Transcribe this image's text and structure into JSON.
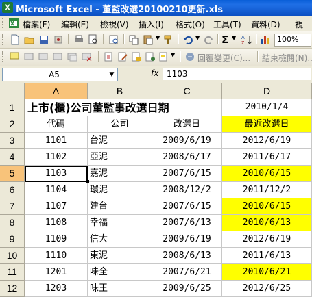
{
  "window": {
    "title": "Microsoft Excel - 董監改選20100210更新.xls",
    "app_icon_letter": "X"
  },
  "menu": [
    "檔案(F)",
    "編輯(E)",
    "檢視(V)",
    "插入(I)",
    "格式(O)",
    "工具(T)",
    "資料(D)",
    "視"
  ],
  "toolbar": {
    "zoom": "100%",
    "sigma": "Σ",
    "reply_changes": "回覆變更(C)...",
    "end_review": "結束檢閱(N)..."
  },
  "formula_bar": {
    "name_box": "A5",
    "fx_label": "fx",
    "content": "1103"
  },
  "columns": [
    "A",
    "B",
    "C",
    "D"
  ],
  "rows": [
    "1",
    "2",
    "3",
    "4",
    "5",
    "6",
    "7",
    "8",
    "9",
    "10",
    "11",
    "12"
  ],
  "sheet": {
    "title": "上市(櫃)公司董監事改選日期",
    "title_date": "2010/1/4",
    "headers": [
      "代碼",
      "公司",
      "改選日",
      "最近改選日"
    ],
    "records": [
      [
        "1101",
        "台泥",
        "2009/6/19",
        "2012/6/19"
      ],
      [
        "1102",
        "亞泥",
        "2008/6/17",
        "2011/6/17"
      ],
      [
        "1103",
        "嘉泥",
        "2007/6/15",
        "2010/6/15"
      ],
      [
        "1104",
        "環泥",
        "2008/12/2",
        "2011/12/2"
      ],
      [
        "1107",
        "建台",
        "2007/6/15",
        "2010/6/15"
      ],
      [
        "1108",
        "幸福",
        "2007/6/13",
        "2010/6/13"
      ],
      [
        "1109",
        "信大",
        "2009/6/19",
        "2012/6/19"
      ],
      [
        "1110",
        "東泥",
        "2008/6/13",
        "2011/6/13"
      ],
      [
        "1201",
        "味全",
        "2007/6/21",
        "2010/6/21"
      ],
      [
        "1203",
        "味王",
        "2009/6/25",
        "2012/6/25"
      ]
    ],
    "highlighted_rows": [
      2,
      4,
      5,
      8
    ]
  },
  "colors": {
    "highlight": "#ffff00",
    "selected_header": "#f8c37a",
    "header_bg": "#ece9d8"
  }
}
